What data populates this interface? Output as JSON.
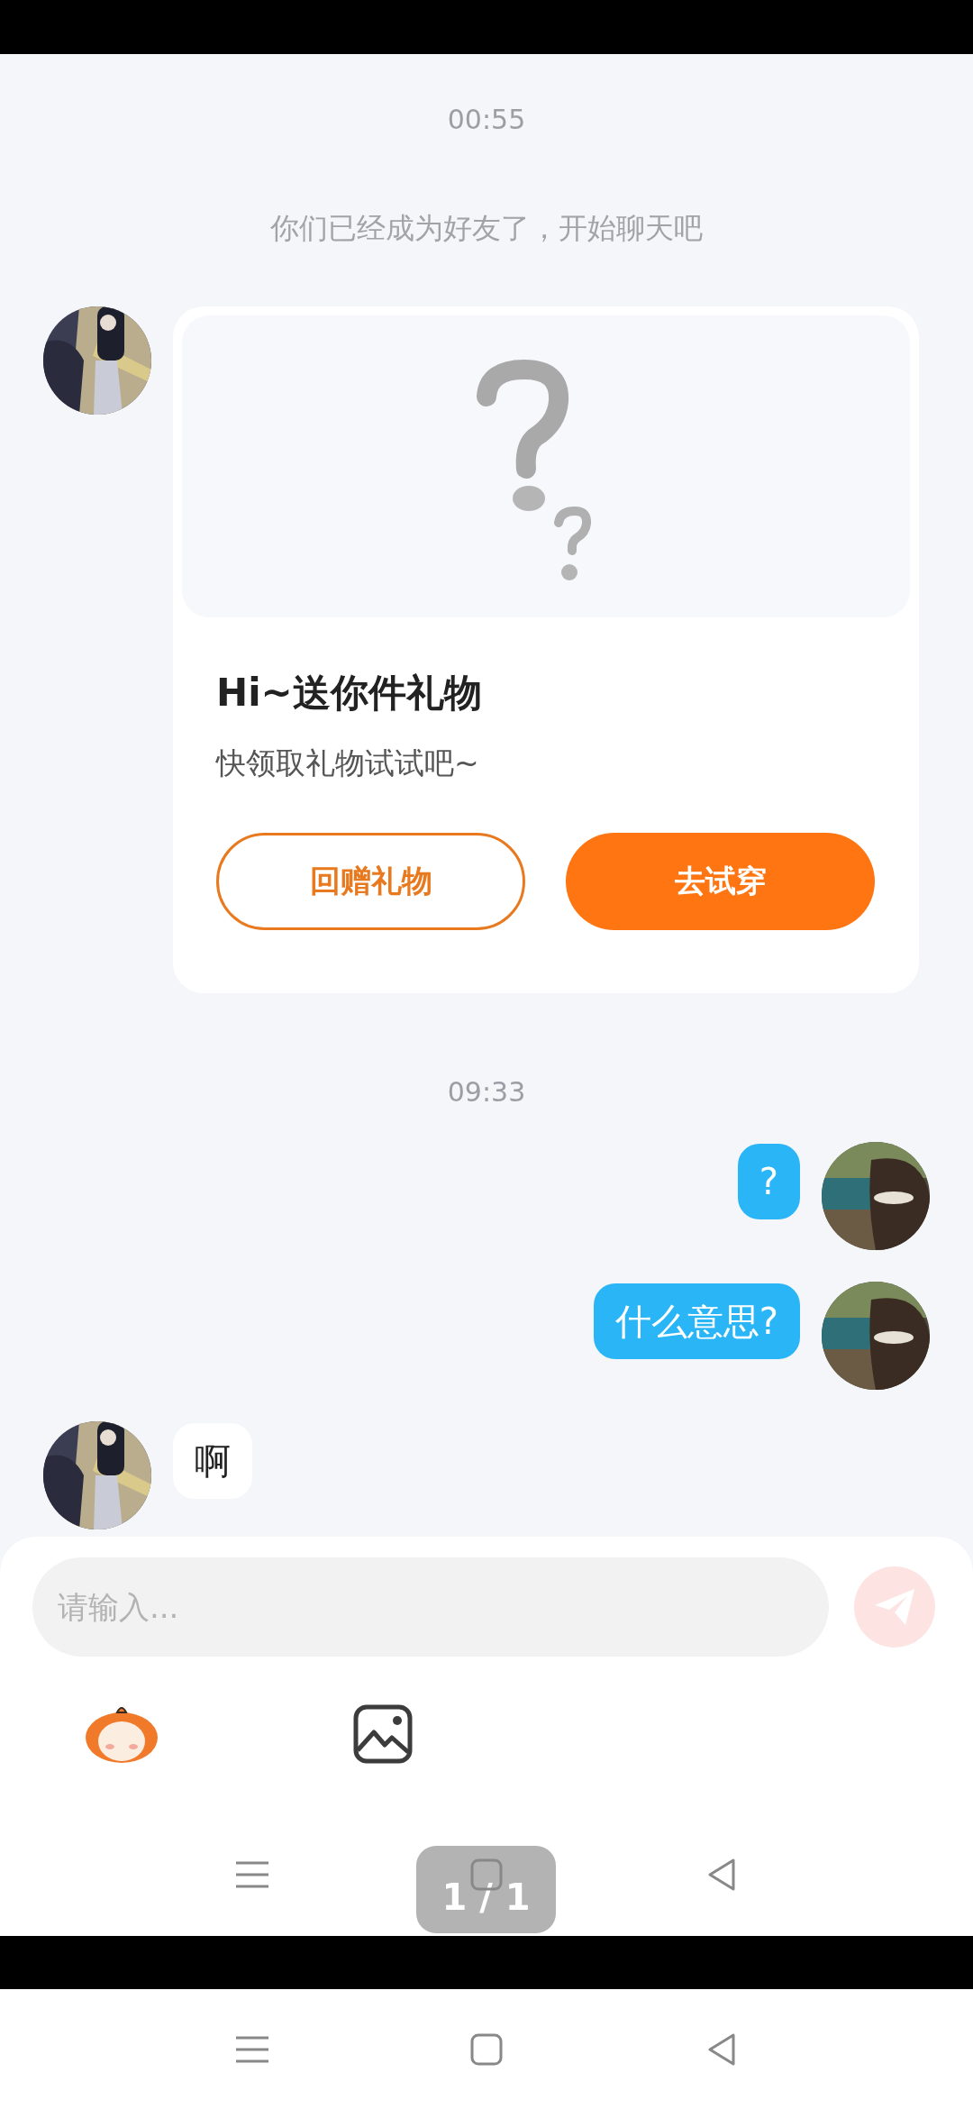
{
  "messages": [
    {
      "kind": "time",
      "text": "00:55"
    },
    {
      "kind": "system",
      "text": "你们已经成为好友了，开始聊天吧"
    },
    {
      "kind": "gift",
      "from_me": false,
      "title": "Hi~送你件礼物",
      "subtitle": "快领取礼物试试吧~",
      "buttons": [
        {
          "label": "回赠礼物",
          "kind": "outline"
        },
        {
          "label": "去试穿",
          "kind": "filled"
        }
      ]
    },
    {
      "kind": "time",
      "text": "09:33"
    },
    {
      "kind": "text",
      "from_me": true,
      "text": "?"
    },
    {
      "kind": "text",
      "from_me": true,
      "text": "什么意思?"
    },
    {
      "kind": "text",
      "from_me": false,
      "text": "啊"
    }
  ],
  "composer": {
    "placeholder": "请输入..."
  },
  "page_indicator": "1 / 1"
}
